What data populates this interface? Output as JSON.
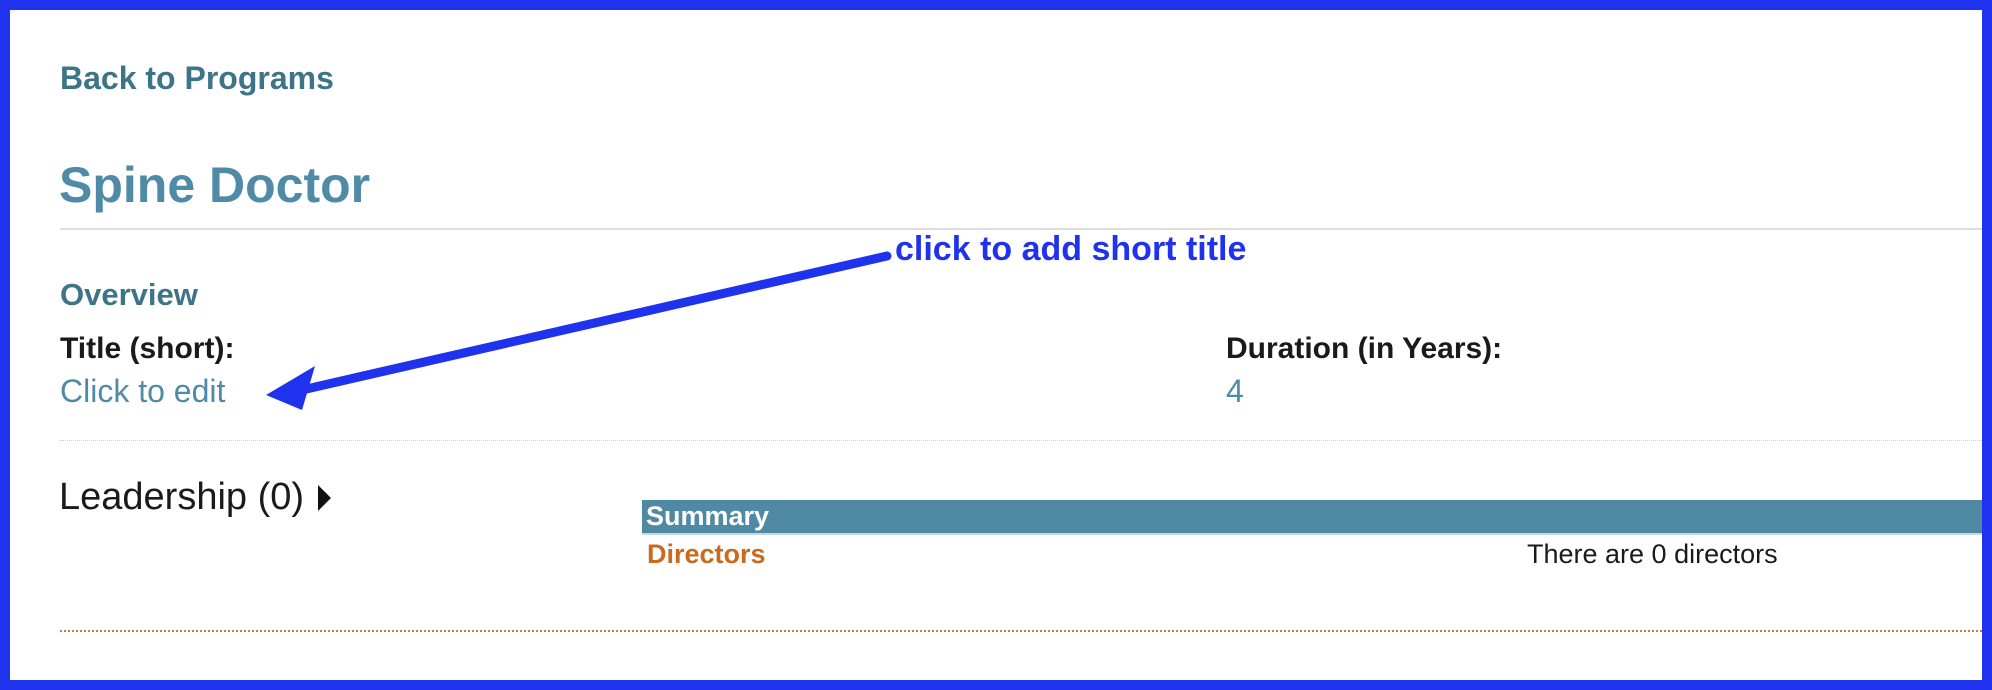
{
  "nav": {
    "back_label": "Back to Programs"
  },
  "page": {
    "title": "Spine Doctor"
  },
  "overview": {
    "heading": "Overview",
    "fields": [
      {
        "label": "Title (short):",
        "value": "Click to edit"
      },
      {
        "label": "Duration (in Years):",
        "value": "4"
      }
    ]
  },
  "leadership": {
    "label": "Leadership (0)",
    "summary": {
      "header": "Summary",
      "rows": [
        {
          "key": "Directors",
          "value": "There are 0 directors"
        }
      ]
    }
  },
  "annotation": {
    "text": "click to add short title",
    "color": "#1f33ee"
  },
  "colors": {
    "link": "#3d7487",
    "title": "#4f8aa6",
    "summary_header": "#4f89a4",
    "accent_orange": "#c96a1e"
  },
  "icons": {
    "expand": "caret-right-icon"
  }
}
